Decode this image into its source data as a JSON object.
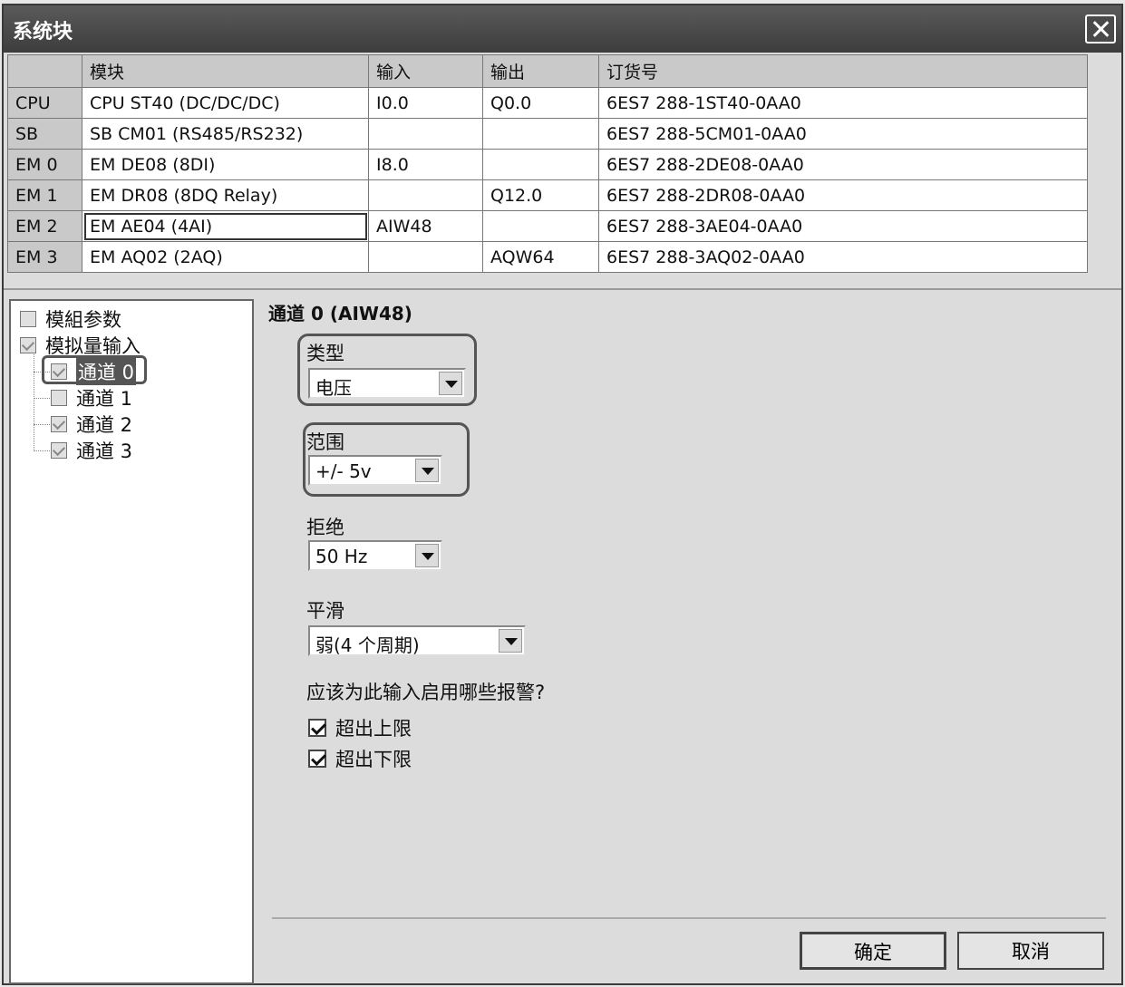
{
  "window": {
    "title": "系统块"
  },
  "modules_table": {
    "headers": [
      "模块",
      "输入",
      "输出",
      "订货号"
    ],
    "rows": [
      {
        "slot": "CPU",
        "module": "CPU ST40 (DC/DC/DC)",
        "input": "I0.0",
        "output": "Q0.0",
        "order": "6ES7 288-1ST40-0AA0"
      },
      {
        "slot": "SB",
        "module": "SB CM01 (RS485/RS232)",
        "input": "",
        "output": "",
        "order": "6ES7 288-5CM01-0AA0"
      },
      {
        "slot": "EM 0",
        "module": "EM DE08 (8DI)",
        "input": "I8.0",
        "output": "",
        "order": "6ES7 288-2DE08-0AA0"
      },
      {
        "slot": "EM 1",
        "module": "EM DR08 (8DQ Relay)",
        "input": "",
        "output": "Q12.0",
        "order": "6ES7 288-2DR08-0AA0"
      },
      {
        "slot": "EM 2",
        "module": "EM AE04 (4AI)",
        "input": "AIW48",
        "output": "",
        "order": "6ES7 288-3AE04-0AA0"
      },
      {
        "slot": "EM 3",
        "module": "EM AQ02 (2AQ)",
        "input": "",
        "output": "AQW64",
        "order": "6ES7 288-3AQ02-0AA0"
      }
    ]
  },
  "tree": {
    "items": [
      {
        "label": "模組参数"
      },
      {
        "label": "模拟量输入"
      },
      {
        "label": "通道 0"
      },
      {
        "label": "通道 1"
      },
      {
        "label": "通道 2"
      },
      {
        "label": "通道 3"
      }
    ]
  },
  "panel": {
    "title": "通道 0 (AIW48)",
    "type_label": "类型",
    "type_value": "电压",
    "range_label": "范围",
    "range_value": "+/- 5v",
    "reject_label": "拒绝",
    "reject_value": "50 Hz",
    "smooth_label": "平滑",
    "smooth_value": "弱(4 个周期)",
    "alarm_question": "应该为此输入启用哪些报警?",
    "alarm_upper": "超出上限",
    "alarm_lower": "超出下限"
  },
  "buttons": {
    "ok": "确定",
    "cancel": "取消"
  }
}
